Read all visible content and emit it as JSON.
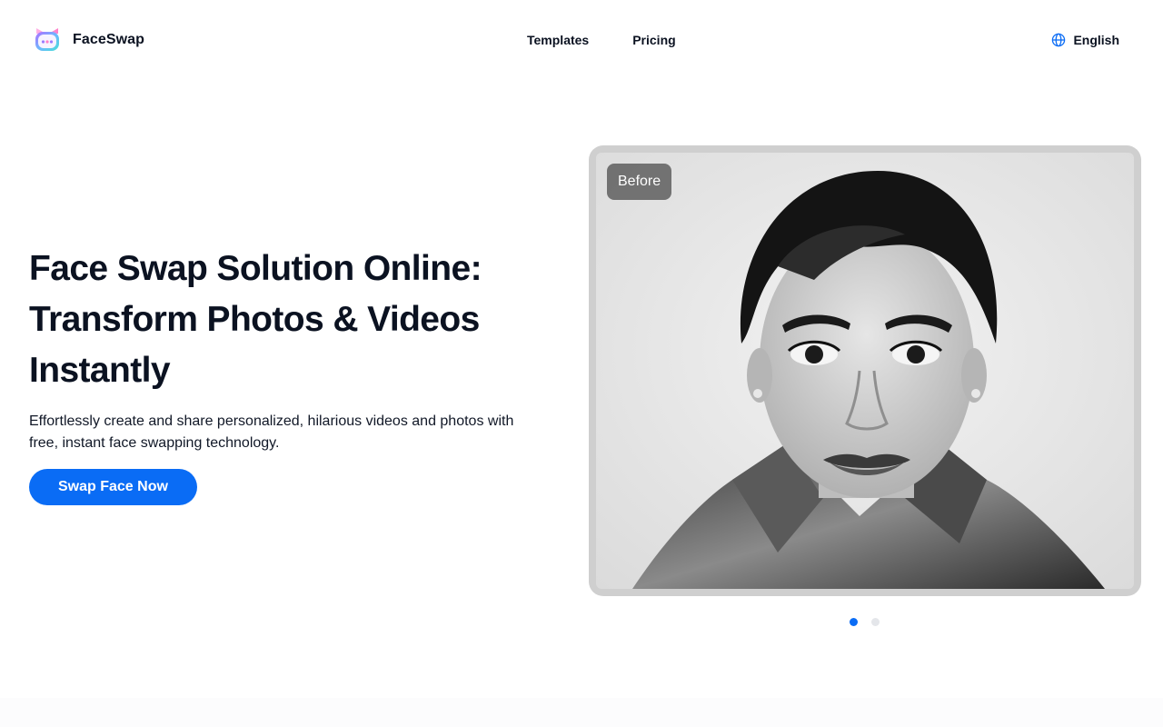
{
  "header": {
    "logo_text": "FaceSwap",
    "nav": [
      {
        "label": "Templates"
      },
      {
        "label": "Pricing"
      }
    ],
    "language": "English",
    "language_icon": "globe-icon"
  },
  "hero": {
    "title_lines": [
      "Face Swap Solution Online:",
      "Transform Photos & Videos",
      "Instantly"
    ],
    "subtitle_lines": [
      "Effortlessly create and share personalized, hilarious videos and photos with",
      "free, instant face swapping technology."
    ],
    "cta_label": "Swap Face Now"
  },
  "showcase": {
    "badge": "Before",
    "active_slide": 1,
    "slide_count": 2
  },
  "colors": {
    "accent": "#0a6cf5",
    "text": "#0b1221",
    "dot_inactive": "#e4e6ea"
  }
}
